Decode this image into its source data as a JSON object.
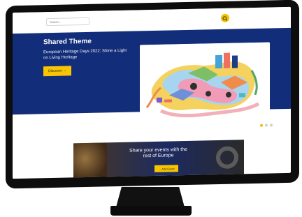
{
  "search": {
    "placeholder": "Search..."
  },
  "hero": {
    "title": "Shared Theme",
    "subtitle": "European Heritage Days 2022: Shine a Light on Living Heritage",
    "button_label": "Discover"
  },
  "carousel": {
    "active_index": 1,
    "count": 3
  },
  "events_banner": {
    "title": "Share your events with the rest of Europe",
    "button_label": "Add Event"
  },
  "colors": {
    "hero_blue": "#122d79",
    "accent_yellow": "#f7c600",
    "monitor_black": "#0d0d0d"
  },
  "icons": {
    "search": "search-icon",
    "arrow": "arrow-right-icon"
  }
}
